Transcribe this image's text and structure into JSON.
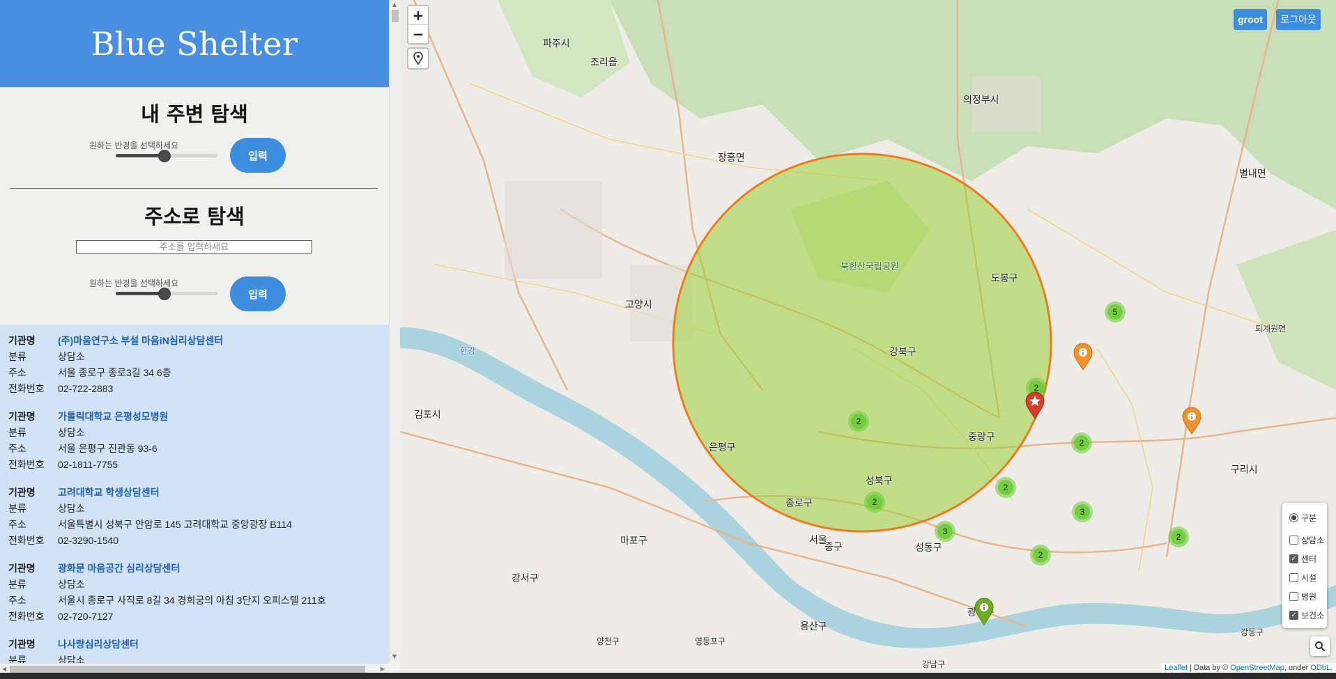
{
  "app": {
    "title": "Blue Shelter"
  },
  "nearby": {
    "title": "내 주변 탐색",
    "radius_label": "원하는 반경을 선택하세요",
    "radius_value": 0.5,
    "button": "입력"
  },
  "address": {
    "title": "주소로 탐색",
    "placeholder": "주소를 입력하세요",
    "radius_label": "원하는 반경을 선택하세요",
    "radius_value": 0.5,
    "button": "입력"
  },
  "results": {
    "labels": {
      "name": "기관명",
      "category": "분류",
      "address": "주소",
      "phone": "전화번호"
    },
    "items": [
      {
        "name": "(주)마음연구소 부설 마음iN심리상담센터",
        "category": "상담소",
        "address": "서울 종로구 종로3길 34 6층",
        "phone": "02-722-2883"
      },
      {
        "name": "가톨릭대학교 은평성모병원",
        "category": "상담소",
        "address": "서울 은평구 진관동 93-6",
        "phone": "02-1811-7755"
      },
      {
        "name": "고려대학교 학생상담센터",
        "category": "상담소",
        "address": "서울특별시 성북구 안암로 145 고려대학교 중앙광장 B114",
        "phone": "02-3290-1540"
      },
      {
        "name": "광화문 마음공간 심리상담센터",
        "category": "상담소",
        "address": "서울시 종로구 사직로 8길 34 경희궁의 아침 3단지 오피스텔 211호",
        "phone": "02-720-7127"
      },
      {
        "name": "나사랑심리상담센터",
        "category": "상담소",
        "address": "",
        "phone": ""
      }
    ]
  },
  "map": {
    "zoom_in": "+",
    "zoom_out": "−",
    "user_button": "groot",
    "logout_button": "로그아웃",
    "clusters": [
      "5",
      "2",
      "2",
      "2",
      "2",
      "2",
      "3",
      "3",
      "2",
      "2"
    ],
    "legend": {
      "group_label": "구분",
      "items": [
        {
          "label": "상담소",
          "checked": false
        },
        {
          "label": "센터",
          "checked": true
        },
        {
          "label": "시설",
          "checked": false
        },
        {
          "label": "병원",
          "checked": false
        },
        {
          "label": "보건소",
          "checked": true
        }
      ]
    },
    "place_labels": [
      "파주시",
      "의정부시",
      "고양시",
      "김포시",
      "도봉구",
      "강북구",
      "은평구",
      "종로구",
      "성북구",
      "중랑구",
      "마포구",
      "강서구",
      "용산구",
      "중구",
      "광진구",
      "성동구",
      "구리시",
      "북한산국립공원",
      "장흥면",
      "별내면",
      "조리읍",
      "한강",
      "서울",
      "영등포구",
      "양천구",
      "강남구",
      "강동구",
      "퇴계원면"
    ],
    "attribution": {
      "leaflet": "Leaflet",
      "data": "| Data by ©",
      "osm": "OpenStreetMap",
      "under": ", under",
      "odbl": "ODbL."
    },
    "colors": {
      "circle": "#f07a1a",
      "circle_fill": "#9fd23a",
      "header": "#4a90e2",
      "button": "#3d8de0",
      "results_bg": "#d3e3f7"
    }
  }
}
